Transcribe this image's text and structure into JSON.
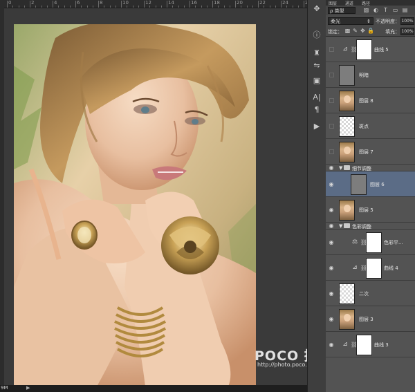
{
  "ruler": {
    "labels": [
      "0",
      "2",
      "4",
      "6",
      "8",
      "10",
      "12",
      "14",
      "16",
      "18",
      "20",
      "22",
      "24",
      "26"
    ]
  },
  "status": {
    "zoom": "9M",
    "arrow": "▶"
  },
  "tools": [
    "move-icon",
    "info-icon",
    "history-icon",
    "brush-icon",
    "adjust-icon",
    "character-icon",
    "paragraph-icon",
    "play-icon"
  ],
  "panel": {
    "tabs": [
      "图层",
      "通道",
      "路径"
    ],
    "filter_label": "ρ 类型",
    "blend_mode": "柔光",
    "opacity_label": "不透明度：",
    "opacity_value": "100%",
    "lock_label": "锁定：",
    "fill_label": "填充：",
    "fill_value": "100%"
  },
  "layers": [
    {
      "name": "曲线 5",
      "kind": "adjustment",
      "icon": "curves-icon",
      "visible": false
    },
    {
      "name": "明暗",
      "kind": "pixel",
      "thumb": "gray",
      "visible": false
    },
    {
      "name": "图层 8",
      "kind": "pixel",
      "thumb": "portrait",
      "visible": false
    },
    {
      "name": "斑点",
      "kind": "pixel",
      "thumb": "checker",
      "visible": false
    },
    {
      "name": "图层 7",
      "kind": "pixel",
      "thumb": "portrait",
      "visible": false
    },
    {
      "name": "细节调整",
      "kind": "group",
      "visible": true
    },
    {
      "name": "图层 6",
      "kind": "pixel",
      "thumb": "gray",
      "visible": true,
      "selected": true,
      "inset": true
    },
    {
      "name": "图层 5",
      "kind": "pixel",
      "thumb": "portrait",
      "visible": true
    },
    {
      "name": "色彩调整",
      "kind": "group",
      "visible": true
    },
    {
      "name": "色彩平...",
      "kind": "adjustment",
      "icon": "balance-icon",
      "visible": true,
      "inset": true
    },
    {
      "name": "曲线 4",
      "kind": "adjustment",
      "icon": "curves-icon",
      "visible": true,
      "inset": true
    },
    {
      "name": "二次",
      "kind": "pixel",
      "thumb": "checker",
      "visible": true
    },
    {
      "name": "图层 3",
      "kind": "pixel",
      "thumb": "portrait",
      "visible": true
    },
    {
      "name": "曲线 3",
      "kind": "adjustment",
      "icon": "curves-icon",
      "visible": true
    }
  ],
  "watermark": {
    "brand": "POCO 摄影专题",
    "url": "http://photo.poco.cn/"
  },
  "colors": {
    "selected_row": "#5b6c86",
    "panel_bg": "#535353",
    "canvas_bg": "#3a3a3a"
  }
}
